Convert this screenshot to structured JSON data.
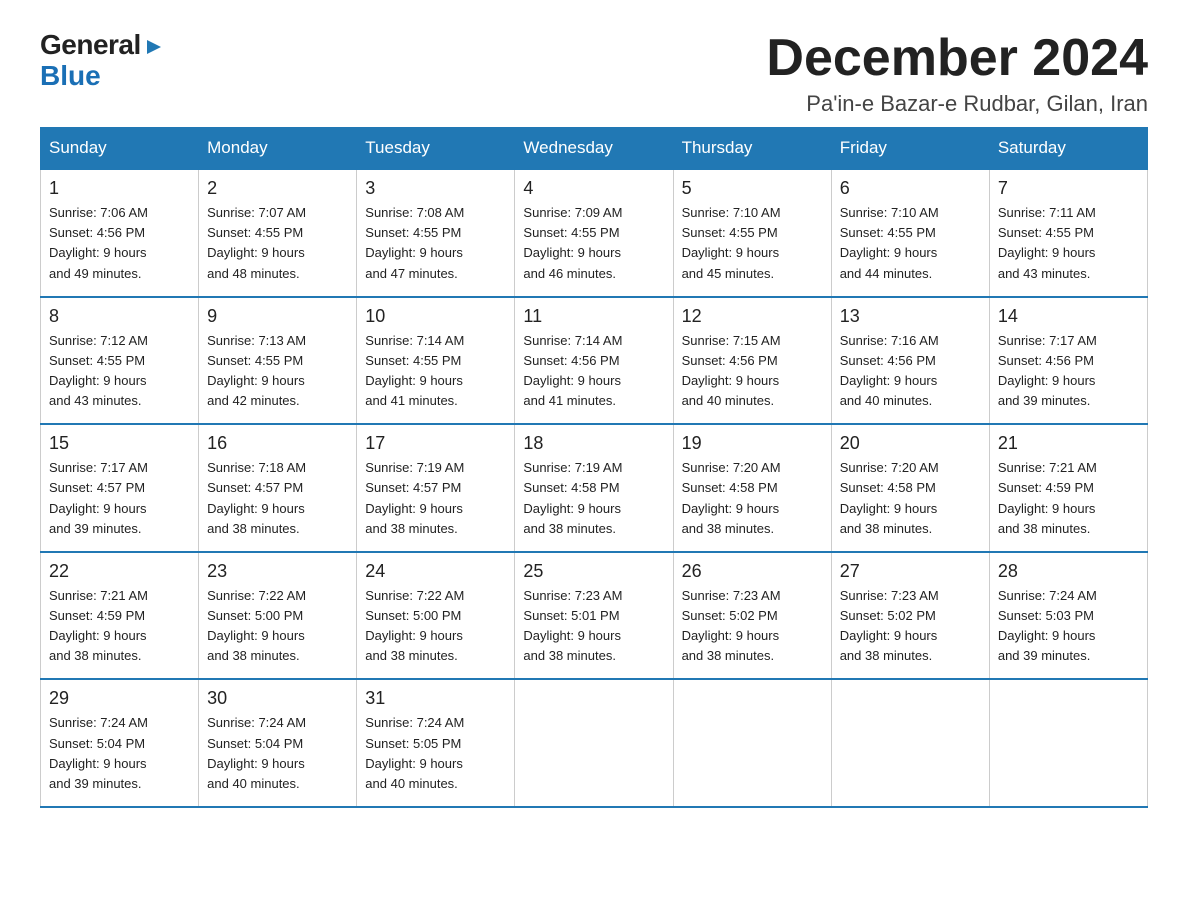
{
  "logo": {
    "general": "General",
    "blue_triangle": "▶",
    "blue": "Blue"
  },
  "header": {
    "month": "December 2024",
    "location": "Pa'in-e Bazar-e Rudbar, Gilan, Iran"
  },
  "weekdays": [
    "Sunday",
    "Monday",
    "Tuesday",
    "Wednesday",
    "Thursday",
    "Friday",
    "Saturday"
  ],
  "weeks": [
    [
      {
        "day": "1",
        "sunrise": "7:06 AM",
        "sunset": "4:56 PM",
        "daylight": "9 hours and 49 minutes."
      },
      {
        "day": "2",
        "sunrise": "7:07 AM",
        "sunset": "4:55 PM",
        "daylight": "9 hours and 48 minutes."
      },
      {
        "day": "3",
        "sunrise": "7:08 AM",
        "sunset": "4:55 PM",
        "daylight": "9 hours and 47 minutes."
      },
      {
        "day": "4",
        "sunrise": "7:09 AM",
        "sunset": "4:55 PM",
        "daylight": "9 hours and 46 minutes."
      },
      {
        "day": "5",
        "sunrise": "7:10 AM",
        "sunset": "4:55 PM",
        "daylight": "9 hours and 45 minutes."
      },
      {
        "day": "6",
        "sunrise": "7:10 AM",
        "sunset": "4:55 PM",
        "daylight": "9 hours and 44 minutes."
      },
      {
        "day": "7",
        "sunrise": "7:11 AM",
        "sunset": "4:55 PM",
        "daylight": "9 hours and 43 minutes."
      }
    ],
    [
      {
        "day": "8",
        "sunrise": "7:12 AM",
        "sunset": "4:55 PM",
        "daylight": "9 hours and 43 minutes."
      },
      {
        "day": "9",
        "sunrise": "7:13 AM",
        "sunset": "4:55 PM",
        "daylight": "9 hours and 42 minutes."
      },
      {
        "day": "10",
        "sunrise": "7:14 AM",
        "sunset": "4:55 PM",
        "daylight": "9 hours and 41 minutes."
      },
      {
        "day": "11",
        "sunrise": "7:14 AM",
        "sunset": "4:56 PM",
        "daylight": "9 hours and 41 minutes."
      },
      {
        "day": "12",
        "sunrise": "7:15 AM",
        "sunset": "4:56 PM",
        "daylight": "9 hours and 40 minutes."
      },
      {
        "day": "13",
        "sunrise": "7:16 AM",
        "sunset": "4:56 PM",
        "daylight": "9 hours and 40 minutes."
      },
      {
        "day": "14",
        "sunrise": "7:17 AM",
        "sunset": "4:56 PM",
        "daylight": "9 hours and 39 minutes."
      }
    ],
    [
      {
        "day": "15",
        "sunrise": "7:17 AM",
        "sunset": "4:57 PM",
        "daylight": "9 hours and 39 minutes."
      },
      {
        "day": "16",
        "sunrise": "7:18 AM",
        "sunset": "4:57 PM",
        "daylight": "9 hours and 38 minutes."
      },
      {
        "day": "17",
        "sunrise": "7:19 AM",
        "sunset": "4:57 PM",
        "daylight": "9 hours and 38 minutes."
      },
      {
        "day": "18",
        "sunrise": "7:19 AM",
        "sunset": "4:58 PM",
        "daylight": "9 hours and 38 minutes."
      },
      {
        "day": "19",
        "sunrise": "7:20 AM",
        "sunset": "4:58 PM",
        "daylight": "9 hours and 38 minutes."
      },
      {
        "day": "20",
        "sunrise": "7:20 AM",
        "sunset": "4:58 PM",
        "daylight": "9 hours and 38 minutes."
      },
      {
        "day": "21",
        "sunrise": "7:21 AM",
        "sunset": "4:59 PM",
        "daylight": "9 hours and 38 minutes."
      }
    ],
    [
      {
        "day": "22",
        "sunrise": "7:21 AM",
        "sunset": "4:59 PM",
        "daylight": "9 hours and 38 minutes."
      },
      {
        "day": "23",
        "sunrise": "7:22 AM",
        "sunset": "5:00 PM",
        "daylight": "9 hours and 38 minutes."
      },
      {
        "day": "24",
        "sunrise": "7:22 AM",
        "sunset": "5:00 PM",
        "daylight": "9 hours and 38 minutes."
      },
      {
        "day": "25",
        "sunrise": "7:23 AM",
        "sunset": "5:01 PM",
        "daylight": "9 hours and 38 minutes."
      },
      {
        "day": "26",
        "sunrise": "7:23 AM",
        "sunset": "5:02 PM",
        "daylight": "9 hours and 38 minutes."
      },
      {
        "day": "27",
        "sunrise": "7:23 AM",
        "sunset": "5:02 PM",
        "daylight": "9 hours and 38 minutes."
      },
      {
        "day": "28",
        "sunrise": "7:24 AM",
        "sunset": "5:03 PM",
        "daylight": "9 hours and 39 minutes."
      }
    ],
    [
      {
        "day": "29",
        "sunrise": "7:24 AM",
        "sunset": "5:04 PM",
        "daylight": "9 hours and 39 minutes."
      },
      {
        "day": "30",
        "sunrise": "7:24 AM",
        "sunset": "5:04 PM",
        "daylight": "9 hours and 40 minutes."
      },
      {
        "day": "31",
        "sunrise": "7:24 AM",
        "sunset": "5:05 PM",
        "daylight": "9 hours and 40 minutes."
      },
      null,
      null,
      null,
      null
    ]
  ],
  "labels": {
    "sunrise": "Sunrise:",
    "sunset": "Sunset:",
    "daylight": "Daylight:"
  }
}
